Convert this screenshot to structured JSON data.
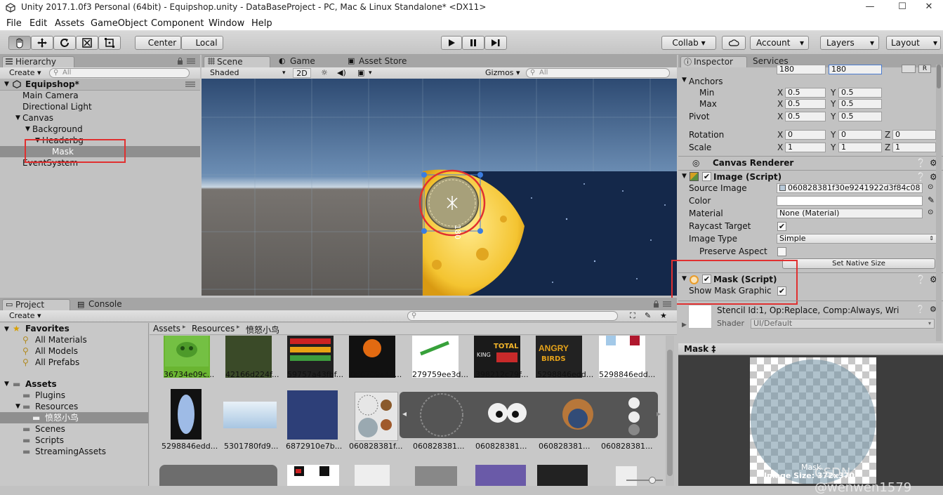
{
  "window": {
    "title": "Unity 2017.1.0f3 Personal (64bit) - Equipshop.unity - DataBaseProject - PC, Mac & Linux Standalone* <DX11>",
    "minimize": "—",
    "maximize": "☐",
    "close": "✕"
  },
  "menu": [
    "File",
    "Edit",
    "Assets",
    "GameObject",
    "Component",
    "Window",
    "Help"
  ],
  "toolbar": {
    "pivot_center": "Center",
    "pivot_local": "Local",
    "collab": "Collab ▾",
    "account": "Account",
    "layers": "Layers",
    "layout": "Layout"
  },
  "hierarchy": {
    "tab": "Hierarchy",
    "create": "Create ▾",
    "search_placeholder": "All",
    "scene": "Equipshop*",
    "items": [
      "Main Camera",
      "Directional Light",
      "Canvas",
      "Background",
      "Headerbg",
      "Mask",
      "EventSystem"
    ]
  },
  "scene": {
    "tabs": [
      "Scene",
      "Game",
      "Asset Store"
    ],
    "shading": "Shaded",
    "mode2d": "2D",
    "gizmos": "Gizmos ▾",
    "search_placeholder": "All",
    "size_label": "180"
  },
  "inspector": {
    "tabs": [
      "Inspector",
      "Services"
    ],
    "size_w": "180",
    "size_h": "180",
    "anchors": "Anchors",
    "min": "Min",
    "max": "Max",
    "pivot": "Pivot",
    "rotation": "Rotation",
    "scale": "Scale",
    "x": "X",
    "y": "Y",
    "z": "Z",
    "anchor_min_x": "0.5",
    "anchor_min_y": "0.5",
    "anchor_max_x": "0.5",
    "anchor_max_y": "0.5",
    "pivot_x": "0.5",
    "pivot_y": "0.5",
    "rot_x": "0",
    "rot_y": "0",
    "rot_z": "0",
    "scale_x": "1",
    "scale_y": "1",
    "scale_z": "1",
    "canvas_renderer": "Canvas Renderer",
    "image_script": "Image (Script)",
    "source_image_label": "Source Image",
    "source_image": "060828381f30e9241922d3f84c08",
    "color_label": "Color",
    "material_label": "Material",
    "material": "None (Material)",
    "raycast_label": "Raycast Target",
    "image_type_label": "Image Type",
    "image_type": "Simple",
    "preserve_label": "Preserve Aspect",
    "native_size": "Set Native Size",
    "mask_script": "Mask (Script)",
    "show_mask_label": "Show Mask Graphic",
    "stencil": "Stencil Id:1, Op:Replace, Comp:Always, Wri",
    "shader_label": "Shader",
    "shader": "UI/Default"
  },
  "preview": {
    "title": "Mask ‡",
    "name": "Mask",
    "size": "Image Size: 372x370",
    "watermark": "CSDN @wenwen1579"
  },
  "project": {
    "tabs": [
      "Project",
      "Console"
    ],
    "create": "Create ▾",
    "favorites": "Favorites",
    "fav_items": [
      "All Materials",
      "All Models",
      "All Prefabs"
    ],
    "assets": "Assets",
    "asset_items": [
      "Plugins",
      "Resources",
      "愤怒小鸟",
      "Scenes",
      "Scripts",
      "StreamingAssets"
    ],
    "breadcrumb": [
      "Assets",
      "Resources",
      "愤怒小鸟"
    ],
    "row1": [
      "36734e09c...",
      "42166d224f...",
      "59757a43fbf...",
      "060709a44...",
      "279759ee3d...",
      "398212c79f...",
      "5298846edd...",
      "5298846edd..."
    ],
    "row2": [
      "5298846edd...",
      "5301780fd9...",
      "6872910e7b...",
      "060828381f...",
      "060828381...",
      "060828381...",
      "060828381...",
      "060828381..."
    ]
  },
  "colors": {
    "panel": "#c2c2c2",
    "tab_strip": "#a5a5a5",
    "selection": "#8f8f8f",
    "highlight_red": "#e03030",
    "sky": "#3d5f86"
  }
}
